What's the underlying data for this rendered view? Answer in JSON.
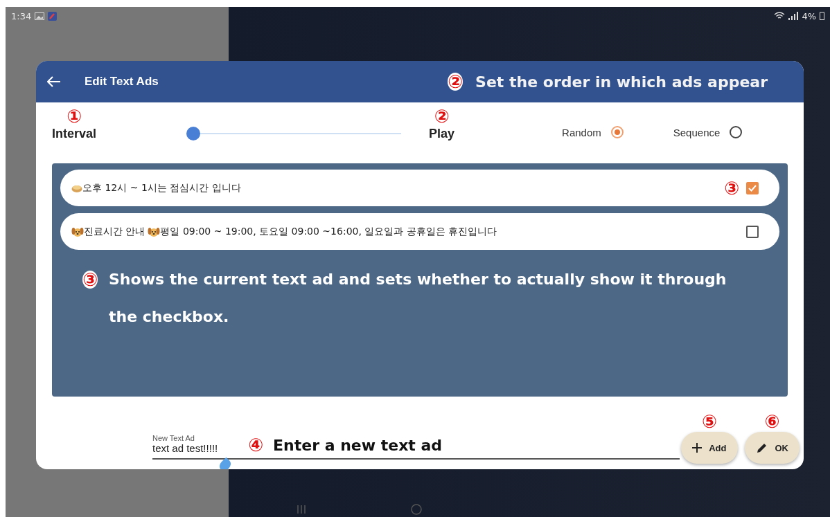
{
  "status_bar": {
    "time": "1:34",
    "battery": "4%"
  },
  "dialog": {
    "title": "Edit Text Ads",
    "header_note": {
      "marker": "②",
      "text": "Set the order in which ads appear"
    },
    "interval": {
      "marker": "①",
      "label": "Interval",
      "level": 0
    },
    "play": {
      "marker": "②",
      "label": "Play",
      "options": [
        {
          "label": "Random",
          "selected": true
        },
        {
          "label": "Sequence",
          "selected": false
        }
      ]
    },
    "ads": [
      {
        "text_parts": [
          "오후 12시 ~ 1시는 점심시간 입니다"
        ],
        "checked": true,
        "marker": "③"
      },
      {
        "text_parts": [
          "진료시간 안내",
          "평일 09:00 ~ 19:00, 토요일 09:00 ~16:00, 일요일과 공휴일은 휴진입니다"
        ],
        "checked": false
      }
    ],
    "panel_note": {
      "marker": "③",
      "text": "Shows the current text ad and sets whether to actually show it through the checkbox."
    },
    "new_ad": {
      "label": "New Text Ad",
      "value": "text ad test!!!!!",
      "marker": "④",
      "note": "Enter a new text ad"
    },
    "buttons": [
      {
        "label": "Add",
        "marker": "⑤",
        "kind": "add"
      },
      {
        "label": "OK",
        "marker": "⑥",
        "kind": "edit"
      }
    ]
  }
}
